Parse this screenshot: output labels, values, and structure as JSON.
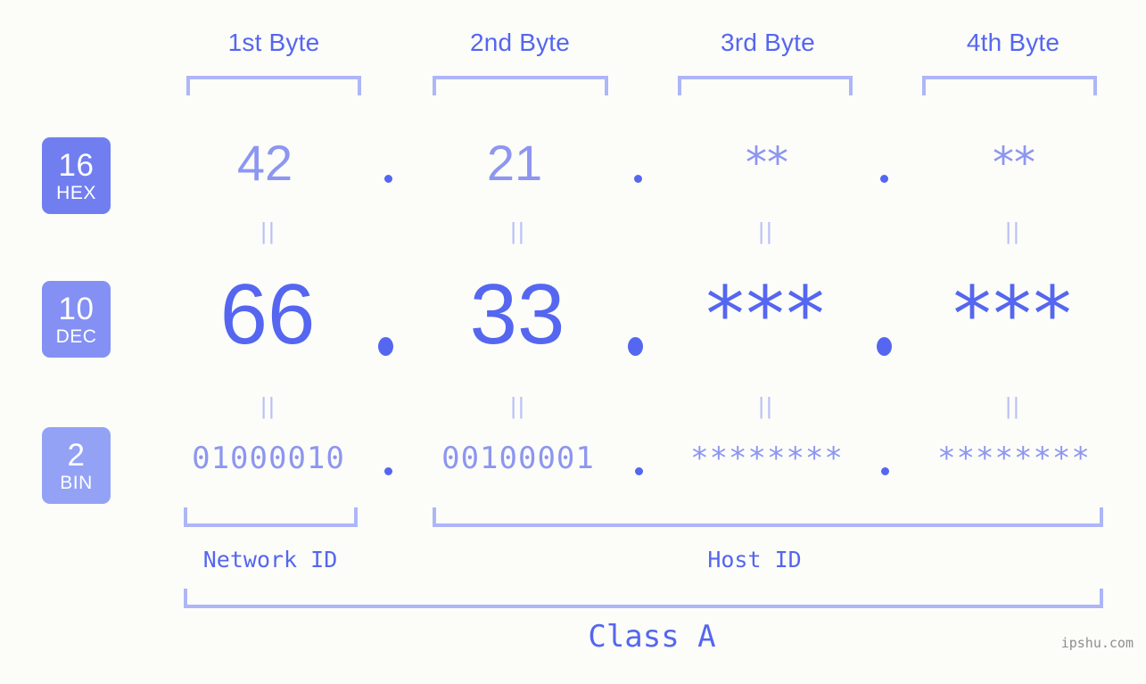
{
  "background_color": "#fcfdf9",
  "accent_colors": {
    "strong_blue": "#5566f0",
    "light_blue": "#8d96f0",
    "bracket_blue": "#aeb6f7",
    "badge_hex": "#717ef0",
    "badge_dec": "#8490f3",
    "badge_bin": "#93a2f5",
    "watermark_gray": "#8e8e8e"
  },
  "byte_headers": [
    {
      "label": "1st Byte"
    },
    {
      "label": "2nd Byte"
    },
    {
      "label": "3rd Byte"
    },
    {
      "label": "4th Byte"
    }
  ],
  "rows": [
    {
      "badge_base": "16",
      "badge_name": "HEX",
      "values": [
        "42",
        "21",
        "**",
        "**"
      ],
      "separator": "."
    },
    {
      "badge_base": "10",
      "badge_name": "DEC",
      "values": [
        "66",
        "33",
        "***",
        "***"
      ],
      "separator": "."
    },
    {
      "badge_base": "2",
      "badge_name": "BIN",
      "values": [
        "01000010",
        "00100001",
        "********",
        "********"
      ],
      "separator": "."
    }
  ],
  "equals_glyph": "||",
  "sections": {
    "network_id": "Network ID",
    "host_id": "Host ID",
    "class": "Class A"
  },
  "watermark": "ipshu.com"
}
